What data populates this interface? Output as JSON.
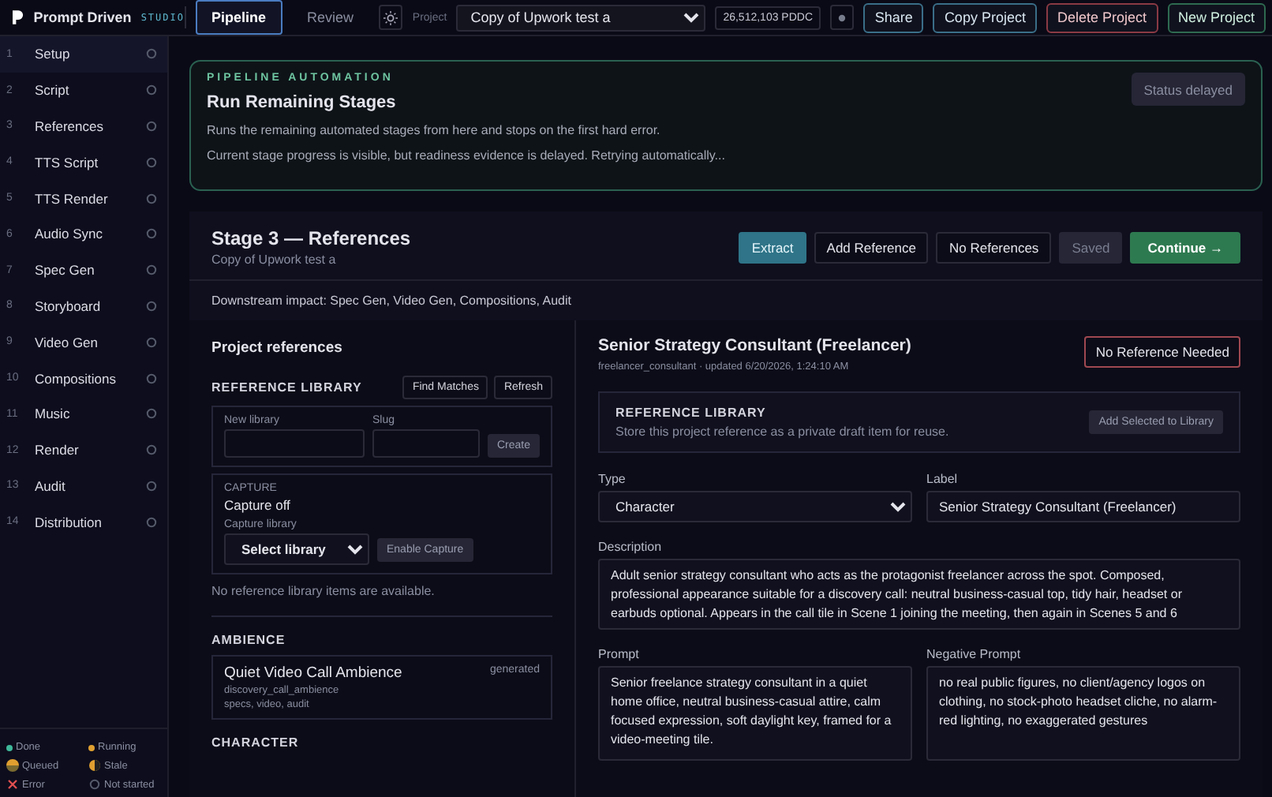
{
  "brand": {
    "name": "Prompt Driven",
    "tag": "STUDIO"
  },
  "tabs": [
    {
      "label": "Pipeline",
      "selected": true
    },
    {
      "label": "Review",
      "selected": false
    }
  ],
  "project": {
    "label": "Project",
    "value": "Copy of Upwork test a"
  },
  "balance": "26,512,103 PDDC",
  "header_buttons": [
    {
      "label": "Share",
      "kind": "info"
    },
    {
      "label": "Copy Project",
      "kind": "info"
    },
    {
      "label": "Delete Project",
      "kind": "danger"
    },
    {
      "label": "New Project",
      "kind": "success"
    }
  ],
  "sidebar": {
    "items": [
      {
        "number": "1",
        "label": "Setup",
        "selected": true,
        "started": false
      },
      {
        "number": "2",
        "label": "Script",
        "selected": false,
        "started": false
      },
      {
        "number": "3",
        "label": "References",
        "selected": false,
        "started": false
      },
      {
        "number": "4",
        "label": "TTS Script",
        "selected": false,
        "started": false
      },
      {
        "number": "5",
        "label": "TTS Render",
        "selected": false,
        "started": false
      },
      {
        "number": "6",
        "label": "Audio Sync",
        "selected": false,
        "started": false
      },
      {
        "number": "7",
        "label": "Spec Gen",
        "selected": false,
        "started": false
      },
      {
        "number": "8",
        "label": "Storyboard",
        "selected": false,
        "started": false
      },
      {
        "number": "9",
        "label": "Video Gen",
        "selected": false,
        "started": false
      },
      {
        "number": "10",
        "label": "Compositions",
        "selected": false,
        "started": false
      },
      {
        "number": "11",
        "label": "Music",
        "selected": false,
        "started": false
      },
      {
        "number": "12",
        "label": "Render",
        "selected": false,
        "started": false
      },
      {
        "number": "13",
        "label": "Audit",
        "selected": false,
        "started": false
      },
      {
        "number": "14",
        "label": "Distribution",
        "selected": false,
        "started": false
      }
    ],
    "legend": [
      {
        "label": "Done",
        "kind": "done"
      },
      {
        "label": "Running",
        "kind": "running"
      },
      {
        "label": "Queued",
        "kind": "queued"
      },
      {
        "label": "Stale",
        "kind": "stale"
      },
      {
        "label": "Error",
        "kind": "error"
      },
      {
        "label": "Not started",
        "kind": "not_started"
      }
    ]
  },
  "automation": {
    "eyebrow": "PIPELINE AUTOMATION",
    "title": "Run Remaining Stages",
    "lines": [
      "Runs the remaining automated stages from here and stops on the first hard error.",
      "Current stage progress is visible, but readiness evidence is delayed. Retrying automatically..."
    ],
    "status": "Status delayed"
  },
  "stage": {
    "title": "Stage 3 — References",
    "subtitle": "Copy of Upwork test a",
    "buttons": [
      {
        "label": "Extract",
        "kind": "primary"
      },
      {
        "label": "Add Reference",
        "kind": "outline"
      },
      {
        "label": "No References",
        "kind": "outline"
      },
      {
        "label": "Saved",
        "kind": "disabled"
      },
      {
        "label": "Continue →",
        "kind": "success"
      }
    ],
    "downstream": "Downstream impact: Spec Gen, Video Gen, Compositions, Audit"
  },
  "references_panel": {
    "title": "Project references",
    "library": {
      "heading": "REFERENCE LIBRARY",
      "buttons": [
        "Find Matches",
        "Refresh"
      ],
      "new_library_label": "New library",
      "slug_label": "Slug",
      "create_button": "Create"
    },
    "capture": {
      "heading": "CAPTURE",
      "status": "Capture off",
      "library_label": "Capture library",
      "select": "Select library",
      "enable_button": "Enable Capture"
    },
    "empty_message": "No reference library items are available.",
    "sections": [
      {
        "heading": "AMBIENCE",
        "items": [
          {
            "title": "Quiet Video Call Ambience",
            "badge": "generated",
            "slug": "discovery_call_ambience",
            "tags": "specs, video, audit"
          }
        ]
      },
      {
        "heading": "CHARACTER"
      }
    ]
  },
  "detail": {
    "title": "Senior Strategy Consultant (Freelancer)",
    "meta": "freelancer_consultant · updated 6/20/2026, 1:24:10 AM",
    "no_reference_button": "No Reference Needed",
    "library": {
      "heading": "REFERENCE LIBRARY",
      "text": "Store this project reference as a private draft item for reuse.",
      "button": "Add Selected to Library"
    },
    "type": {
      "label": "Type",
      "value": "Character"
    },
    "label_field": {
      "label": "Label",
      "value": "Senior Strategy Consultant (Freelancer)"
    },
    "description": {
      "label": "Description",
      "value": "Adult senior strategy consultant who acts as the protagonist freelancer across the spot. Composed, professional appearance suitable for a discovery call: neutral business-casual top, tidy hair, headset or earbuds optional. Appears in the call tile in Scene 1 joining the meeting, then again in Scenes 5 and 6"
    },
    "prompt": {
      "label": "Prompt",
      "value": "Senior freelance strategy consultant in a quiet home office, neutral business-casual attire, calm focused expression, soft daylight key, framed for a video-meeting tile."
    },
    "negative_prompt": {
      "label": "Negative Prompt",
      "value": "no real public figures, no client/agency logos on clothing, no stock-photo headset cliche, no alarm-red lighting, no exaggerated gestures"
    }
  }
}
